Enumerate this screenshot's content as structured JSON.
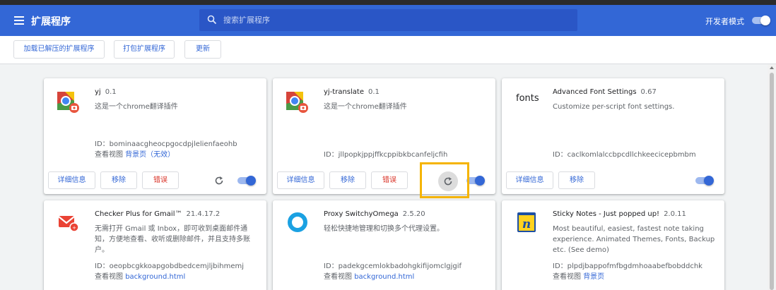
{
  "header": {
    "title": "扩展程序",
    "search_placeholder": "搜索扩展程序",
    "dev_mode_label": "开发者模式",
    "dev_mode_on": true,
    "colors": {
      "bar": "#3367d6",
      "search": "#2a56c6"
    }
  },
  "toolbar": {
    "load_unpacked": "加载已解压的扩展程序",
    "pack": "打包扩展程序",
    "update": "更新"
  },
  "buttons": {
    "details": "详细信息",
    "remove": "移除",
    "errors": "错误"
  },
  "extensions": [
    {
      "name": "yj",
      "version": "0.1",
      "description": "这是一个chrome翻译插件",
      "id_text": "ID：bominaacgheocpgocdpjlelienfaeohb",
      "views_label": "查看视图",
      "view_link": "背景页（无效）",
      "icon": "chrome-translate-icon",
      "enabled": true,
      "has_errors": true
    },
    {
      "name": "yj-translate",
      "version": "0.1",
      "description": "这是一个chrome翻译插件",
      "id_text": "ID：jllpopkjppjffkcppibkbcanfeljcfih",
      "icon": "chrome-translate-icon",
      "enabled": true,
      "has_errors": true
    },
    {
      "name": "Advanced Font Settings",
      "version": "0.67",
      "description": "Customize per-script font settings.",
      "id_text": "ID：caclkomlalccbpcdllchkeecicepbmbm",
      "icon_text": "fonts",
      "enabled": true,
      "has_errors": false
    },
    {
      "name": "Checker Plus for Gmail™",
      "version": "21.4.17.2",
      "description": "无需打开 Gmail 或 Inbox，即可收到桌面邮件通知，方便地查看、收听或删除邮件，并且支持多账户。",
      "id_text": "ID：oeopbcgkkoapgobdbedcemjljbihmemj",
      "views_label": "查看视图",
      "view_link": "background.html",
      "icon": "gmail-checker-icon"
    },
    {
      "name": "Proxy SwitchyOmega",
      "version": "2.5.20",
      "description": "轻松快捷地管理和切换多个代理设置。",
      "id_text": "ID：padekgcemlokbadohgkifijomclgjgif",
      "views_label": "查看视图",
      "view_link": "background.html",
      "icon": "switchyomega-icon"
    },
    {
      "name": "Sticky Notes - Just popped up!",
      "version": "2.0.11",
      "description": "Most beautiful, easiest, fastest note taking experience. Animated Themes, Fonts, Backup etc. (See demo)",
      "id_text": "ID：plpdjbappofmfbgdmhoaabefbobddchk",
      "views_label": "查看视图",
      "view_link": "背景页",
      "icon": "sticky-notes-icon"
    }
  ]
}
